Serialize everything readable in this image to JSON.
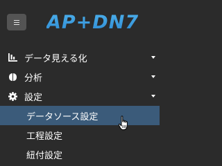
{
  "header": {
    "menu_toggle_icon": "hamburger-icon",
    "logo_text": "AP+DN7"
  },
  "nav": {
    "items": [
      {
        "label": "データ見える化",
        "icon": "chart-icon",
        "expandable": true
      },
      {
        "label": "分析",
        "icon": "brain-icon",
        "expandable": true
      },
      {
        "label": "設定",
        "icon": "gear-icon",
        "expandable": true,
        "expanded": true
      }
    ],
    "settings_subitems": [
      {
        "label": "データソース設定",
        "active": true
      },
      {
        "label": "工程設定",
        "active": false
      },
      {
        "label": "紐付設定",
        "active": false
      }
    ]
  },
  "colors": {
    "background": "#2b2b2b",
    "toggle_bg": "#545454",
    "logo": "#3a9bdc",
    "active_item_bg": "#3b5b7a",
    "text": "#ffffff"
  }
}
